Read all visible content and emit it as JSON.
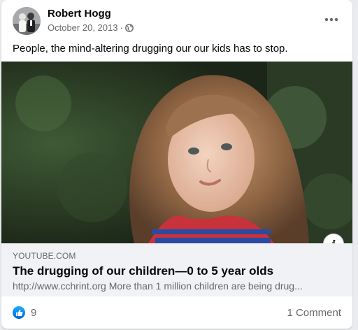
{
  "post": {
    "author": "Robert Hogg",
    "date": "October 20, 2013",
    "separator": "·",
    "privacy_icon": "globe-icon",
    "text": "People, the mind-altering drugging our our kids has to stop."
  },
  "link_preview": {
    "domain": "YOUTUBE.COM",
    "title": "The drugging of our children—0 to 5 year olds",
    "description": "http://www.cchrint.org More than 1 million children are being drug..."
  },
  "footer": {
    "like_count": "9",
    "comments": "1 Comment"
  },
  "icons": {
    "more": "more-options-icon",
    "info": "info-icon",
    "like": "like-icon"
  },
  "colors": {
    "like_blue": "#0866ff",
    "secondary_text": "#65676b",
    "link_box_bg": "#f0f2f5"
  }
}
